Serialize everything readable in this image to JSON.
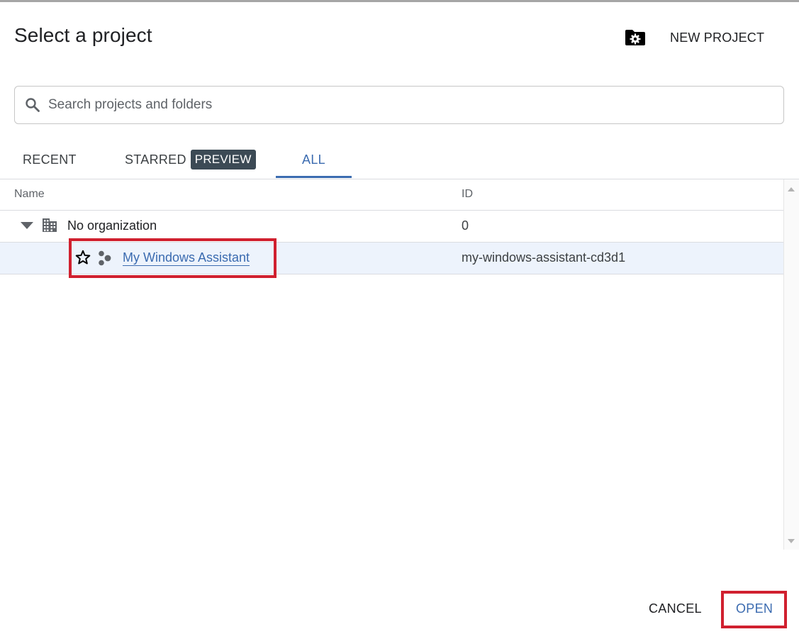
{
  "dialog": {
    "title": "Select a project",
    "new_project_label": "NEW PROJECT",
    "new_project_icon": "folder-settings-icon"
  },
  "search": {
    "placeholder": "Search projects and folders",
    "value": "",
    "icon": "search-icon"
  },
  "tabs": [
    {
      "label": "RECENT",
      "selected": false
    },
    {
      "label": "STARRED",
      "badge": "PREVIEW",
      "selected": false
    },
    {
      "label": "ALL",
      "selected": true
    }
  ],
  "table": {
    "columns": [
      "Name",
      "ID"
    ],
    "organization": {
      "name": "No organization",
      "id": "0",
      "expanded": true,
      "icon": "building-icon"
    },
    "projects": [
      {
        "name": "My Windows Assistant",
        "id": "my-windows-assistant-cd3d1",
        "starred": false,
        "selected": true,
        "icon": "project-icon"
      }
    ]
  },
  "footer": {
    "cancel_label": "CANCEL",
    "open_label": "OPEN"
  },
  "colors": {
    "accent": "#3b6bb0",
    "selected_row_bg": "#edf3fc",
    "badge_bg": "#3c4a55",
    "annotation_red": "#d0202f"
  }
}
